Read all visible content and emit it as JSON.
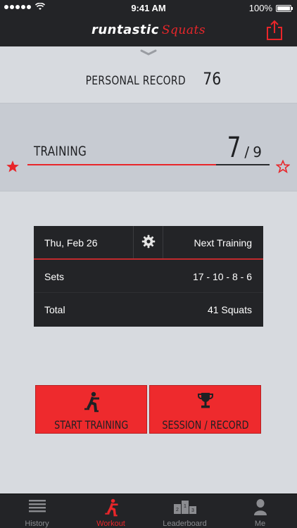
{
  "status_bar": {
    "time": "9:41 AM",
    "battery": "100%",
    "signal_icon": "signal-dots-icon",
    "wifi_icon": "wifi-icon",
    "battery_icon": "battery-icon"
  },
  "header": {
    "brand": "runtastic",
    "product": "Squats",
    "share_icon": "share-icon"
  },
  "personal_record": {
    "label": "PERSONAL RECORD",
    "value": "76"
  },
  "training": {
    "label": "TRAINING",
    "current": "7",
    "separator": "/",
    "total": "9",
    "progress_fraction": 0.78,
    "accent": "#e8262a"
  },
  "plan": {
    "date": "Thu, Feb 26",
    "settings_icon": "gear-icon",
    "next_label": "Next Training",
    "rows": [
      {
        "label": "Sets",
        "value": "17 - 10 - 8 - 6"
      },
      {
        "label": "Total",
        "value": "41 Squats"
      }
    ]
  },
  "buttons": {
    "start": "START TRAINING",
    "session": "SESSION / RECORD"
  },
  "tabs": [
    {
      "label": "History",
      "icon": "list-icon"
    },
    {
      "label": "Workout",
      "icon": "squat-icon"
    },
    {
      "label": "Leaderboard",
      "icon": "podium-icon"
    },
    {
      "label": "Me",
      "icon": "person-icon"
    }
  ],
  "colors": {
    "accent": "#e8262a",
    "dark": "#232427",
    "background": "#d7dadf"
  }
}
